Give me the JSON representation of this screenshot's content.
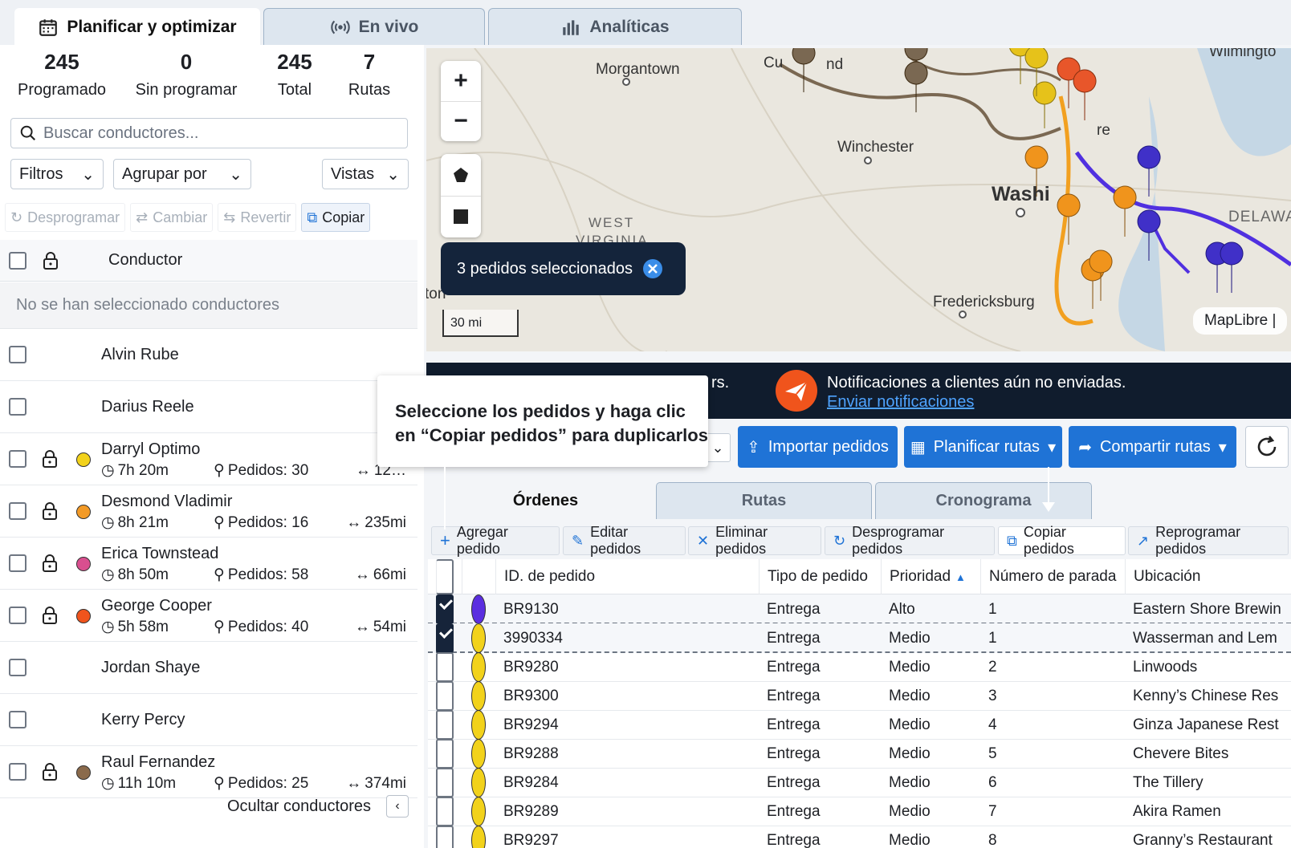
{
  "tabs": [
    {
      "label": "Planificar y optimizar",
      "icon": "calendar-icon"
    },
    {
      "label": "En vivo",
      "icon": "live-signal-icon"
    },
    {
      "label": "Analíticas",
      "icon": "bar-chart-icon"
    }
  ],
  "stats": [
    {
      "value": "245",
      "label": "Programado"
    },
    {
      "value": "0",
      "label": "Sin programar"
    },
    {
      "value": "245",
      "label": "Total"
    },
    {
      "value": "7",
      "label": "Rutas"
    }
  ],
  "search": {
    "placeholder": "Buscar conductores..."
  },
  "dropdowns": {
    "filters": "Filtros",
    "group": "Agrupar por",
    "views": "Vistas"
  },
  "driver_actions": {
    "unschedule": "Desprogramar",
    "change": "Cambiar",
    "revert": "Revertir",
    "copy": "Copiar"
  },
  "driver_table": {
    "header": "Conductor",
    "empty": "No se han seleccionado conductores"
  },
  "drivers": [
    {
      "name": "Alvin Rube"
    },
    {
      "name": "Darius Reele"
    },
    {
      "name": "Darryl Optimo",
      "color": "#f2d21b",
      "time": "7h 20m",
      "orders": "Pedidos: 30",
      "dist": "12…"
    },
    {
      "name": "Desmond Vladimir",
      "color": "#f39a26",
      "time": "8h 21m",
      "orders": "Pedidos: 16",
      "dist": "235mi"
    },
    {
      "name": "Erica Townstead",
      "color": "#d94f8f",
      "time": "8h 50m",
      "orders": "Pedidos: 58",
      "dist": "66mi"
    },
    {
      "name": "George Cooper",
      "color": "#f0541c",
      "time": "5h 58m",
      "orders": "Pedidos: 40",
      "dist": "54mi"
    },
    {
      "name": "Jordan Shaye"
    },
    {
      "name": "Kerry Percy"
    },
    {
      "name": "Raul Fernandez",
      "color": "#8a6a4b",
      "time": "11h 10m",
      "orders": "Pedidos: 25",
      "dist": "374mi"
    }
  ],
  "hide_drivers": "Ocultar conductores",
  "map": {
    "labels": {
      "morgantown": "Morgantown",
      "winchester": "Winchester",
      "washington": "Washi",
      "west": "WEST",
      "virginia": "VIRGINIA",
      "fredericksburg": "Fredericksburg",
      "delaware": "DELAWA",
      "wilmington": "Wilmingto",
      "ton": "ton",
      "cumberland": "Cu",
      "nd": "nd",
      "re": "re"
    },
    "selected_badge": "3 pedidos seleccionados",
    "scale": "30 mi",
    "attribution": "MapLibre |"
  },
  "notification": {
    "left_text": "rs.",
    "text": "Notificaciones a clientes aún no enviadas.",
    "link": "Enviar notificaciones"
  },
  "tooltip": {
    "line1": "Seleccione los pedidos y haga clic",
    "line2": "en “Copiar pedidos” para duplicarlos"
  },
  "toolbar": {
    "import": "Importar pedidos",
    "plan": "Planificar rutas",
    "share": "Compartir rutas"
  },
  "lower_tabs": [
    "Órdenes",
    "Rutas",
    "Cronograma"
  ],
  "order_actions": {
    "add": "Agregar pedido",
    "edit": "Editar pedidos",
    "delete": "Eliminar pedidos",
    "unschedule": "Desprogramar pedidos",
    "copy": "Copiar pedidos",
    "reschedule": "Reprogramar pedidos"
  },
  "columns": {
    "id": "ID. de pedido",
    "type": "Tipo de pedido",
    "priority": "Prioridad",
    "stop": "Número de parada",
    "location": "Ubicación"
  },
  "orders": [
    {
      "checked": true,
      "color": "#5b2ee0",
      "id": "BR9130",
      "type": "Entrega",
      "priority": "Alto",
      "stop": "1",
      "location": "Eastern Shore Brewin"
    },
    {
      "checked": true,
      "color": "#f2d21b",
      "id": "3990334",
      "type": "Entrega",
      "priority": "Medio",
      "stop": "1",
      "location": "Wasserman and Lem"
    },
    {
      "checked": false,
      "color": "#f2d21b",
      "id": "BR9280",
      "type": "Entrega",
      "priority": "Medio",
      "stop": "2",
      "location": "Linwoods"
    },
    {
      "checked": false,
      "color": "#f2d21b",
      "id": "BR9300",
      "type": "Entrega",
      "priority": "Medio",
      "stop": "3",
      "location": "Kenny’s Chinese Res"
    },
    {
      "checked": false,
      "color": "#f2d21b",
      "id": "BR9294",
      "type": "Entrega",
      "priority": "Medio",
      "stop": "4",
      "location": "Ginza Japanese Rest"
    },
    {
      "checked": false,
      "color": "#f2d21b",
      "id": "BR9288",
      "type": "Entrega",
      "priority": "Medio",
      "stop": "5",
      "location": "Chevere Bites"
    },
    {
      "checked": false,
      "color": "#f2d21b",
      "id": "BR9284",
      "type": "Entrega",
      "priority": "Medio",
      "stop": "6",
      "location": "The Tillery"
    },
    {
      "checked": false,
      "color": "#f2d21b",
      "id": "BR9289",
      "type": "Entrega",
      "priority": "Medio",
      "stop": "7",
      "location": "Akira Ramen"
    },
    {
      "checked": false,
      "color": "#f2d21b",
      "id": "BR9297",
      "type": "Entrega",
      "priority": "Medio",
      "stop": "8",
      "location": "Granny’s Restaurant"
    }
  ]
}
